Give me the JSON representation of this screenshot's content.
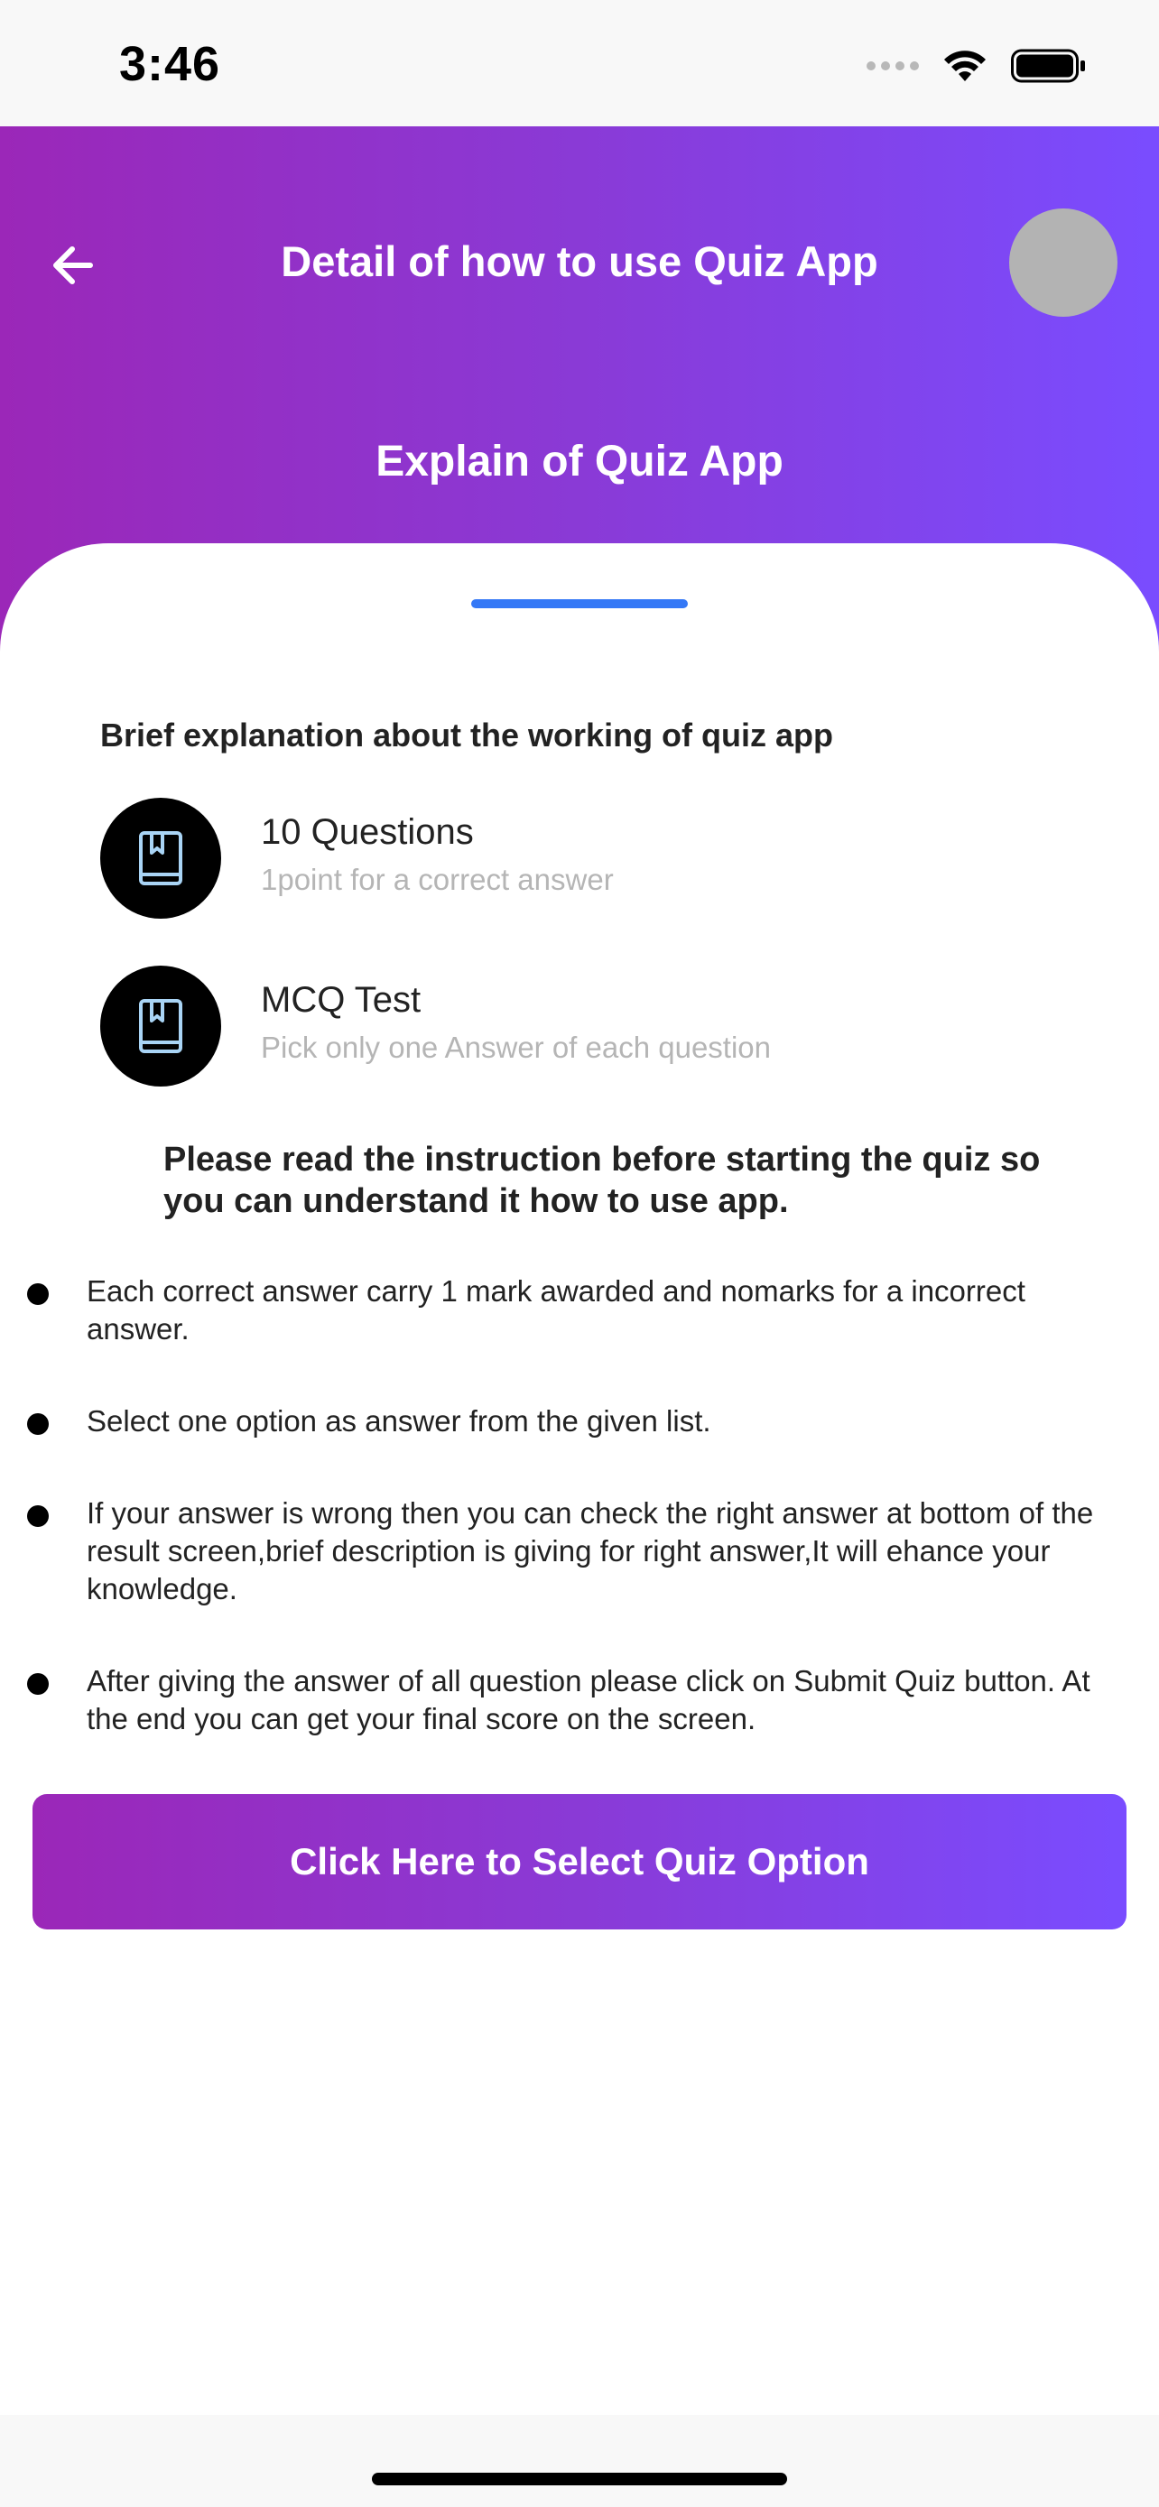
{
  "status_bar": {
    "time": "3:46"
  },
  "header": {
    "title": "Detail of how to use Quiz App",
    "subtitle": "Explain of Quiz App",
    "gradient_start": "#9b27b8",
    "gradient_end": "#7a4cff"
  },
  "content": {
    "intro": "Brief explanation about the working of quiz app",
    "features": [
      {
        "icon": "bookmark-book-icon",
        "title": "10 Questions",
        "subtitle": "1point for a correct answer"
      },
      {
        "icon": "bookmark-book-icon",
        "title": "MCQ Test",
        "subtitle": "Pick only one Answer of each question"
      }
    ],
    "notice": "Please read the instruction before starting the quiz so you can understand it how to use app.",
    "instructions": [
      "Each correct answer carry 1 mark awarded and nomarks for a incorrect answer.",
      "Select one option as answer from the given list.",
      "If your answer is wrong then you can check the right answer at bottom of the result screen,brief description is giving for right answer,It will ehance your knowledge.",
      "After giving the answer of all question please click on Submit Quiz button. At the end you can get your final score on the screen."
    ]
  },
  "cta": {
    "label": "Click Here to Select Quiz Option"
  },
  "colors": {
    "accent": "#3478f6",
    "icon_tint": "#a9d4f5"
  }
}
